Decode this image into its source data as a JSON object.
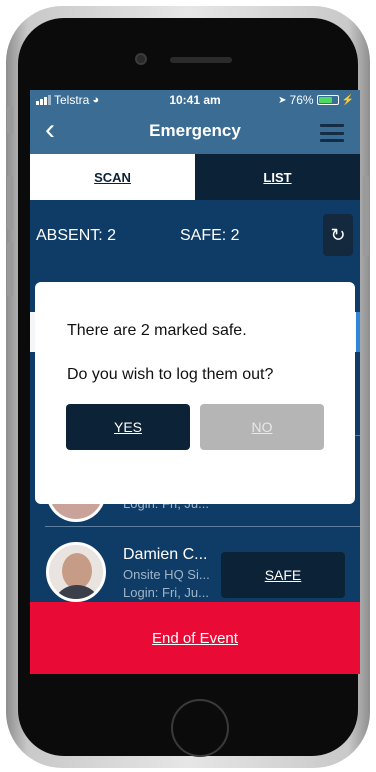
{
  "status_bar": {
    "carrier": "Telstra",
    "time": "10:41 am",
    "battery": "76%",
    "battery_level": 76
  },
  "nav": {
    "back_icon": "chevron-left-icon",
    "title": "Emergency",
    "menu_icon": "hamburger-menu-icon"
  },
  "tabs": [
    {
      "label": "SCAN",
      "active": true
    },
    {
      "label": "LIST",
      "active": false
    }
  ],
  "counts": {
    "absent": "ABSENT: 2",
    "safe": "SAFE: 2",
    "refresh_icon": "refresh-icon"
  },
  "list": {
    "faded_row": {
      "sub_text": "Login: Fri, Ju..."
    },
    "row": {
      "name": "Damien C...",
      "location": "Onsite HQ Si...",
      "login": "Login: Fri, Ju...",
      "action_label": "SAFE"
    }
  },
  "footer": {
    "end_event_label": "End of Event"
  },
  "dialog": {
    "message_1": "There are 2 marked safe.",
    "message_2": "Do you wish to log them out?",
    "yes_label": "YES",
    "no_label": "NO"
  },
  "colors": {
    "screen_bg": "#0f3c66",
    "nav_bg": "#3a6c94",
    "dark_button": "#0c2236",
    "end_bar": "#ea0a36"
  }
}
